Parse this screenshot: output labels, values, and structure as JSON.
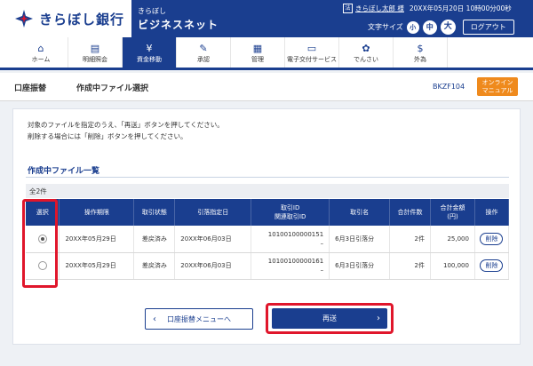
{
  "header": {
    "bank_name": "きらぼし銀行",
    "service_small": "きらぼし",
    "service_big": "ビジネスネット",
    "user_icon": "法",
    "user_name": "きらぼし太郎 様",
    "datetime": "20XX年05月20日 10時00分00秒",
    "font_size_label": "文字サイズ",
    "font_small": "小",
    "font_mid": "中",
    "font_big": "大",
    "logout": "ログアウト"
  },
  "nav": [
    {
      "label": "ホーム",
      "icon": "home-icon",
      "glyph": "⌂"
    },
    {
      "label": "明細照会",
      "icon": "document-icon",
      "glyph": "▤"
    },
    {
      "label": "資金移動",
      "icon": "yen-icon",
      "glyph": "¥"
    },
    {
      "label": "承認",
      "icon": "approve-icon",
      "glyph": "✎"
    },
    {
      "label": "管理",
      "icon": "admin-icon",
      "glyph": "▦"
    },
    {
      "label": "電子交付サービス",
      "icon": "e-delivery-icon",
      "glyph": "▭"
    },
    {
      "label": "でんさい",
      "icon": "densai-icon",
      "glyph": "✿"
    },
    {
      "label": "外為",
      "icon": "forex-icon",
      "glyph": "$"
    }
  ],
  "title": {
    "main": "口座振替",
    "sub": "作成中ファイル選択",
    "code": "BKZF104",
    "manual_line1": "オンライン",
    "manual_line2": "マニュアル"
  },
  "messages": {
    "line1": "対象のファイルを指定のうえ、「再送」ボタンを押してください。",
    "line2": "削除する場合には「削除」ボタンを押してください。"
  },
  "list": {
    "title": "作成中ファイル一覧",
    "count": "全2件",
    "headers": [
      "選択",
      "操作期限",
      "取引状態",
      "引落指定日",
      "取引ID\n関連取引ID",
      "取引名",
      "合計件数",
      "合計金額\n(円)",
      "操作"
    ],
    "rows": [
      {
        "selected": true,
        "deadline": "20XX年05月29日",
        "status": "差戻済み",
        "date": "20XX年06月03日",
        "trade_id": "10100100000151",
        "related_id": "–",
        "name": "6月3日引落分",
        "count": "2件",
        "amount": "25,000",
        "action": "削除"
      },
      {
        "selected": false,
        "deadline": "20XX年05月29日",
        "status": "差戻済み",
        "date": "20XX年06月03日",
        "trade_id": "10100100000161",
        "related_id": "–",
        "name": "6月3日引落分",
        "count": "2件",
        "amount": "100,000",
        "action": "削除"
      }
    ]
  },
  "buttons": {
    "back": "口座振替メニューへ",
    "resend": "再送"
  }
}
